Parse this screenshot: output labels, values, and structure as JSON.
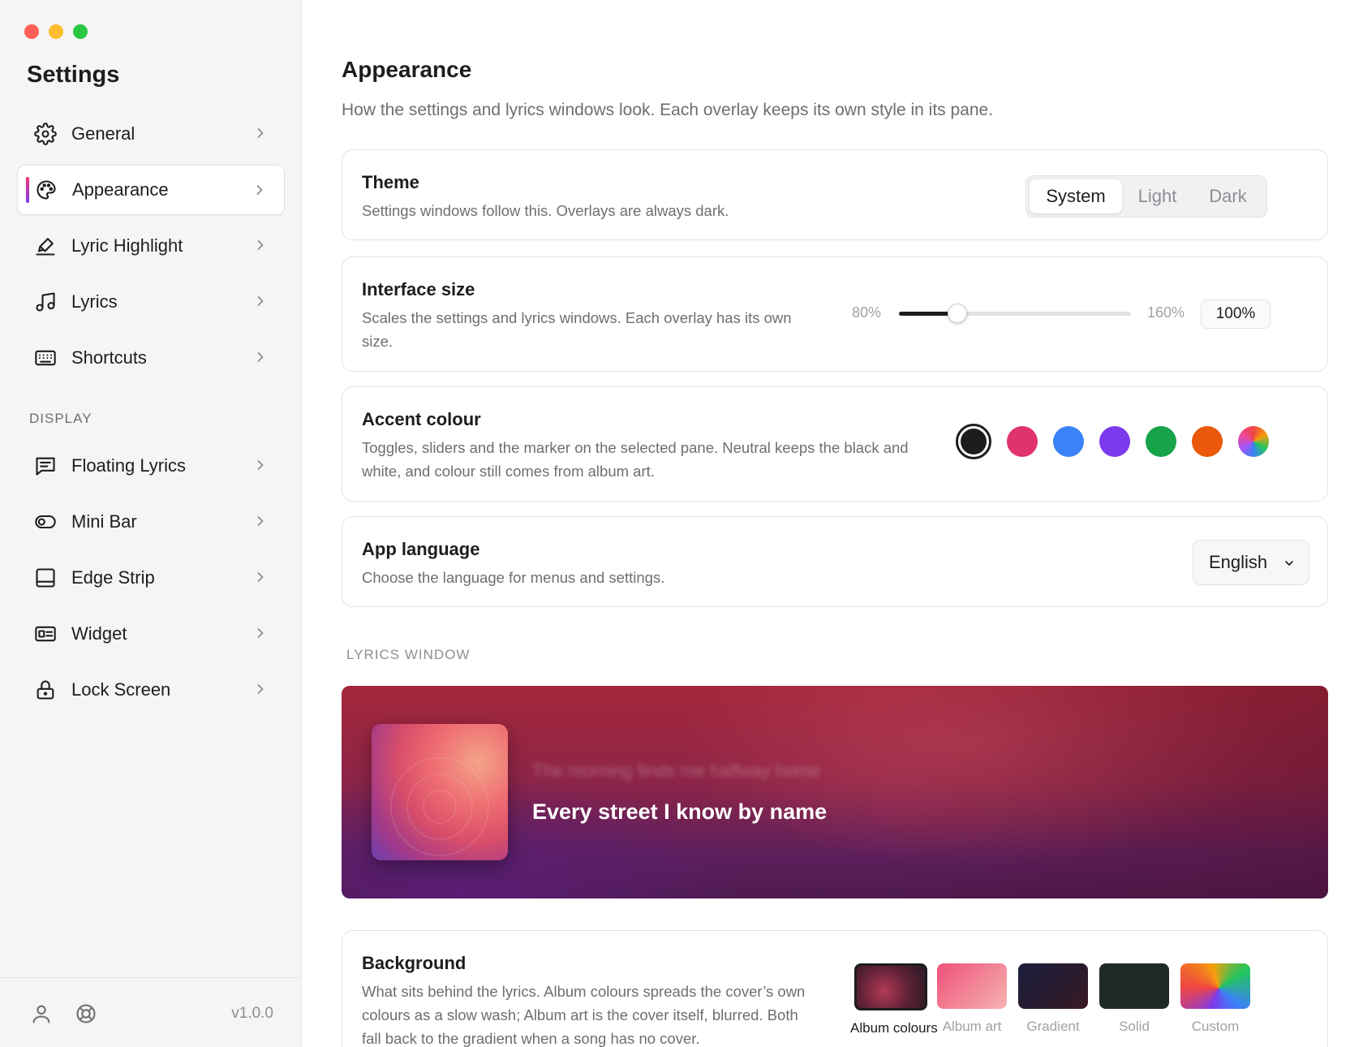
{
  "window": {
    "title": "Settings"
  },
  "sidebar": {
    "items": [
      {
        "label": "General",
        "icon": "gear-icon"
      },
      {
        "label": "Appearance",
        "icon": "palette-icon",
        "active": true
      },
      {
        "label": "Lyric Highlight",
        "icon": "highlighter-icon"
      },
      {
        "label": "Lyrics",
        "icon": "music-note-icon"
      },
      {
        "label": "Shortcuts",
        "icon": "keyboard-icon"
      }
    ],
    "display_section": "DISPLAY",
    "display_items": [
      {
        "label": "Floating Lyrics",
        "icon": "lyrics-panel-icon"
      },
      {
        "label": "Mini Bar",
        "icon": "toggle-pill-icon"
      },
      {
        "label": "Edge Strip",
        "icon": "edge-strip-icon"
      },
      {
        "label": "Widget",
        "icon": "widget-card-icon"
      },
      {
        "label": "Lock Screen",
        "icon": "lock-icon"
      }
    ],
    "version": "v1.0.0"
  },
  "main": {
    "title": "Appearance",
    "description": "How the settings and lyrics windows look. Each overlay keeps its own style in its pane.",
    "theme": {
      "title": "Theme",
      "description": "Settings windows follow this. Overlays are always dark.",
      "options": [
        "System",
        "Light",
        "Dark"
      ],
      "selected": "System"
    },
    "interface_size": {
      "title": "Interface size",
      "description_line1": "Scales the settings and lyrics windows. Each overlay has its own",
      "description_line2": "size.",
      "min_label": "80%",
      "max_label": "160%",
      "value_label": "100%",
      "value_fraction": 0.25
    },
    "accent": {
      "title": "Accent colour",
      "description_line1": "Toggles, sliders and the marker on the selected pane. Neutral keeps the black and",
      "description_line2": "white, and colour still comes from album art.",
      "colors": [
        "#1d1d1f",
        "#e0336b",
        "#3b82f6",
        "#7c3aed",
        "#16a34a",
        "#ea580c",
        "multicolor"
      ],
      "selected_index": 0
    },
    "language": {
      "title": "App language",
      "description": "Choose the language for menus and settings.",
      "value": "English"
    },
    "lyrics_window_label": "LYRICS WINDOW",
    "preview": {
      "previous_line": "The morning finds me halfway home",
      "current_line": "Every street I know by name"
    },
    "background": {
      "title": "Background",
      "description_line1": "What sits behind the lyrics. Album colours spreads the cover’s own",
      "description_line2": "colours as a slow wash; Album art is the cover itself, blurred. Both",
      "description_line3": "fall back to the gradient when a song has no cover.",
      "options": [
        "Album colours",
        "Album art",
        "Gradient",
        "Solid",
        "Custom"
      ],
      "selected": "Album colours"
    }
  }
}
